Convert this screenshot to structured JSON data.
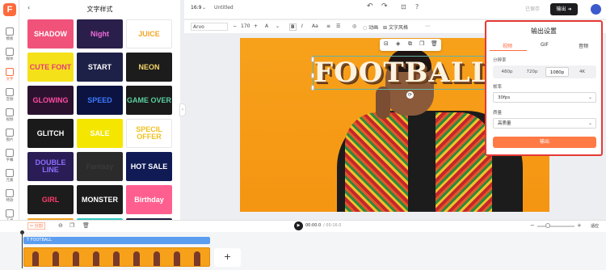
{
  "rail": {
    "items": [
      {
        "label": "模板",
        "icon": "layout-icon"
      },
      {
        "label": "媒体",
        "icon": "folder-icon"
      },
      {
        "label": "文字",
        "icon": "text-icon",
        "active": true
      },
      {
        "label": "音频",
        "icon": "music-icon"
      },
      {
        "label": "视频",
        "icon": "video-icon"
      },
      {
        "label": "图片",
        "icon": "image-icon"
      },
      {
        "label": "字幕",
        "icon": "subtitle-icon"
      },
      {
        "label": "元素",
        "icon": "elements-icon"
      },
      {
        "label": "特效",
        "icon": "effects-icon"
      },
      {
        "label": "工具",
        "icon": "tools-icon"
      }
    ]
  },
  "panel": {
    "title": "文字样式",
    "tiles": [
      {
        "label": "SHADOW",
        "bg": "#f0527a",
        "fg": "#ffffff"
      },
      {
        "label": "Night",
        "bg": "#2a1f4a",
        "fg": "#f06bd8"
      },
      {
        "label": "JUICE",
        "bg": "#ffffff",
        "fg": "#f5a623"
      },
      {
        "label": "CUTE FONT",
        "bg": "#f5e11a",
        "fg": "#e63a79"
      },
      {
        "label": "START",
        "bg": "#1e2147",
        "fg": "#ffffff"
      },
      {
        "label": "NEON",
        "bg": "#1c1c1c",
        "fg": "#f5d66b"
      },
      {
        "label": "GLOWING",
        "bg": "#2b1330",
        "fg": "#ff4aa0"
      },
      {
        "label": "SPEED",
        "bg": "#0c1340",
        "fg": "#3d7aff"
      },
      {
        "label": "GAME OVER",
        "bg": "#1a1a1a",
        "fg": "#5ad0a0"
      },
      {
        "label": "GLITCH",
        "bg": "#1a1a1a",
        "fg": "#ffffff"
      },
      {
        "label": "SALE",
        "bg": "#f5e600",
        "fg": "#ffffff"
      },
      {
        "label": "SPECIL OFFER",
        "bg": "#ffffff",
        "fg": "#f0c020"
      },
      {
        "label": "DOUBLE LINE",
        "bg": "#2a1d55",
        "fg": "#8e6dff"
      },
      {
        "label": "Fantasy",
        "bg": "#2b2b2b",
        "fg": "#3a3a3a"
      },
      {
        "label": "HOT SALE",
        "bg": "#101a55",
        "fg": "#ffffff"
      },
      {
        "label": "GIRL",
        "bg": "#1c1c1c",
        "fg": "#ff3b6b"
      },
      {
        "label": "MONSTER",
        "bg": "#1c1c1c",
        "fg": "#ffffff"
      },
      {
        "label": "Birthday",
        "bg": "#ff5f8f",
        "fg": "#ffffff"
      }
    ]
  },
  "topbar": {
    "ratio": "16:9",
    "doc_title": "Untitled",
    "saved_text": "已保存",
    "export_label": "输出"
  },
  "toolbar": {
    "font": "Arvo",
    "size": "170",
    "animation_label": "动画",
    "text_style_label": "文字风格"
  },
  "canvas": {
    "headline": "FOOTBALL",
    "bg_color": "#f59512"
  },
  "export_panel": {
    "title": "输出设置",
    "tabs": [
      "视频",
      "GIF",
      "音频"
    ],
    "resolution_label": "分辨率",
    "resolutions": [
      "480p",
      "720p",
      "1080p",
      "4K"
    ],
    "selected_resolution": "1080p",
    "framerate_label": "帧率",
    "framerate_value": "30fps",
    "quality_label": "质量",
    "quality_value": "高质量",
    "export_button": "输出",
    "accent": "#ff6a3c"
  },
  "timeline": {
    "current_time": "00:00.0",
    "total_time": "/ 00:16.0",
    "text_track_label": "FOOTBALL",
    "fit_label": "适应",
    "split_label": "分割"
  }
}
